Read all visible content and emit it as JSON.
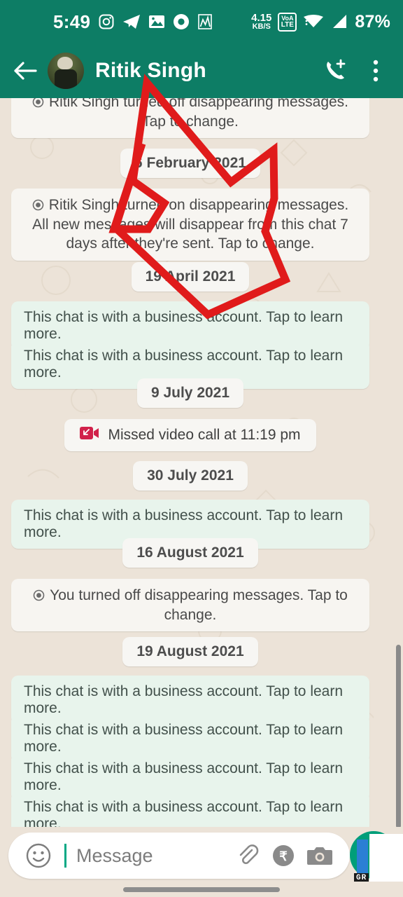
{
  "status_bar": {
    "time": "5:49",
    "left_icons": [
      "instagram-icon",
      "telegram-icon",
      "gallery-icon",
      "circle-app-icon",
      "chart-app-icon"
    ],
    "network_speed_value": "4.15",
    "network_speed_unit": "KB/S",
    "volte_top": "VoA",
    "volte_bottom": "LTE",
    "right_icons": [
      "volte-icon",
      "wifi-icon",
      "cellular-signal-icon"
    ],
    "battery": "87%"
  },
  "app_bar": {
    "back_icon": "back-arrow-icon",
    "avatar": "contact-avatar",
    "contact_name": "Ritik Singh",
    "call_icon": "add-call-icon",
    "menu_icon": "overflow-menu-icon"
  },
  "chat": {
    "messages": [
      {
        "type": "system",
        "text": "Ritik Singh turned off disappearing messages. Tap to change."
      },
      {
        "type": "date",
        "text": "6 February 2021"
      },
      {
        "type": "system",
        "text": "Ritik Singh turned on disappearing messages. All new messages will disappear from this chat 7 days after they're sent. Tap to change."
      },
      {
        "type": "date",
        "text": "19 April 2021"
      },
      {
        "type": "business",
        "text": "This chat is with a business account. Tap to learn more."
      },
      {
        "type": "business",
        "text": "This chat is with a business account. Tap to learn more."
      },
      {
        "type": "date",
        "text": "9 July 2021"
      },
      {
        "type": "call",
        "text": "Missed video call at 11:19 pm",
        "icon": "missed-video-call-icon"
      },
      {
        "type": "date",
        "text": "30 July 2021"
      },
      {
        "type": "business",
        "text": "This chat is with a business account. Tap to learn more."
      },
      {
        "type": "date",
        "text": "16 August 2021"
      },
      {
        "type": "system",
        "text": "You turned off disappearing messages. Tap to change."
      },
      {
        "type": "date",
        "text": "19 August 2021"
      },
      {
        "type": "business",
        "text": "This chat is with a business account. Tap to learn more."
      },
      {
        "type": "business",
        "text": "This chat is with a business account. Tap to learn more."
      },
      {
        "type": "business",
        "text": "This chat is with a business account. Tap to learn more."
      },
      {
        "type": "business",
        "text": "This chat is with a business account. Tap to learn more."
      }
    ]
  },
  "composer": {
    "emoji_icon": "emoji-icon",
    "placeholder": "Message",
    "attach_icon": "attachment-paperclip-icon",
    "payment_icon": "rupee-payment-icon",
    "camera_icon": "camera-icon",
    "send_fab_icon": "voice-record-fab"
  },
  "overlay": {
    "watermark": "GR"
  },
  "colors": {
    "header_green": "#0d7d65",
    "chat_background": "#ece3d8",
    "business_bubble": "#e8f4ec",
    "system_bubble": "#f7f5f1",
    "annotation_red": "#e01b1b",
    "fab_green": "#009e79",
    "caret_green": "#00a884"
  }
}
